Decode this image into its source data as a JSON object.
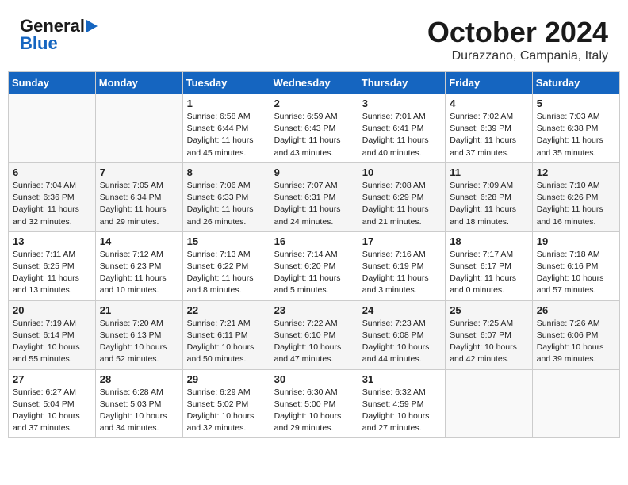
{
  "header": {
    "logo_general": "General",
    "logo_blue": "Blue",
    "month_title": "October 2024",
    "location": "Durazzano, Campania, Italy"
  },
  "columns": [
    "Sunday",
    "Monday",
    "Tuesday",
    "Wednesday",
    "Thursday",
    "Friday",
    "Saturday"
  ],
  "weeks": [
    {
      "days": [
        {
          "num": "",
          "detail": ""
        },
        {
          "num": "",
          "detail": ""
        },
        {
          "num": "1",
          "detail": "Sunrise: 6:58 AM\nSunset: 6:44 PM\nDaylight: 11 hours and 45 minutes."
        },
        {
          "num": "2",
          "detail": "Sunrise: 6:59 AM\nSunset: 6:43 PM\nDaylight: 11 hours and 43 minutes."
        },
        {
          "num": "3",
          "detail": "Sunrise: 7:01 AM\nSunset: 6:41 PM\nDaylight: 11 hours and 40 minutes."
        },
        {
          "num": "4",
          "detail": "Sunrise: 7:02 AM\nSunset: 6:39 PM\nDaylight: 11 hours and 37 minutes."
        },
        {
          "num": "5",
          "detail": "Sunrise: 7:03 AM\nSunset: 6:38 PM\nDaylight: 11 hours and 35 minutes."
        }
      ]
    },
    {
      "days": [
        {
          "num": "6",
          "detail": "Sunrise: 7:04 AM\nSunset: 6:36 PM\nDaylight: 11 hours and 32 minutes."
        },
        {
          "num": "7",
          "detail": "Sunrise: 7:05 AM\nSunset: 6:34 PM\nDaylight: 11 hours and 29 minutes."
        },
        {
          "num": "8",
          "detail": "Sunrise: 7:06 AM\nSunset: 6:33 PM\nDaylight: 11 hours and 26 minutes."
        },
        {
          "num": "9",
          "detail": "Sunrise: 7:07 AM\nSunset: 6:31 PM\nDaylight: 11 hours and 24 minutes."
        },
        {
          "num": "10",
          "detail": "Sunrise: 7:08 AM\nSunset: 6:29 PM\nDaylight: 11 hours and 21 minutes."
        },
        {
          "num": "11",
          "detail": "Sunrise: 7:09 AM\nSunset: 6:28 PM\nDaylight: 11 hours and 18 minutes."
        },
        {
          "num": "12",
          "detail": "Sunrise: 7:10 AM\nSunset: 6:26 PM\nDaylight: 11 hours and 16 minutes."
        }
      ]
    },
    {
      "days": [
        {
          "num": "13",
          "detail": "Sunrise: 7:11 AM\nSunset: 6:25 PM\nDaylight: 11 hours and 13 minutes."
        },
        {
          "num": "14",
          "detail": "Sunrise: 7:12 AM\nSunset: 6:23 PM\nDaylight: 11 hours and 10 minutes."
        },
        {
          "num": "15",
          "detail": "Sunrise: 7:13 AM\nSunset: 6:22 PM\nDaylight: 11 hours and 8 minutes."
        },
        {
          "num": "16",
          "detail": "Sunrise: 7:14 AM\nSunset: 6:20 PM\nDaylight: 11 hours and 5 minutes."
        },
        {
          "num": "17",
          "detail": "Sunrise: 7:16 AM\nSunset: 6:19 PM\nDaylight: 11 hours and 3 minutes."
        },
        {
          "num": "18",
          "detail": "Sunrise: 7:17 AM\nSunset: 6:17 PM\nDaylight: 11 hours and 0 minutes."
        },
        {
          "num": "19",
          "detail": "Sunrise: 7:18 AM\nSunset: 6:16 PM\nDaylight: 10 hours and 57 minutes."
        }
      ]
    },
    {
      "days": [
        {
          "num": "20",
          "detail": "Sunrise: 7:19 AM\nSunset: 6:14 PM\nDaylight: 10 hours and 55 minutes."
        },
        {
          "num": "21",
          "detail": "Sunrise: 7:20 AM\nSunset: 6:13 PM\nDaylight: 10 hours and 52 minutes."
        },
        {
          "num": "22",
          "detail": "Sunrise: 7:21 AM\nSunset: 6:11 PM\nDaylight: 10 hours and 50 minutes."
        },
        {
          "num": "23",
          "detail": "Sunrise: 7:22 AM\nSunset: 6:10 PM\nDaylight: 10 hours and 47 minutes."
        },
        {
          "num": "24",
          "detail": "Sunrise: 7:23 AM\nSunset: 6:08 PM\nDaylight: 10 hours and 44 minutes."
        },
        {
          "num": "25",
          "detail": "Sunrise: 7:25 AM\nSunset: 6:07 PM\nDaylight: 10 hours and 42 minutes."
        },
        {
          "num": "26",
          "detail": "Sunrise: 7:26 AM\nSunset: 6:06 PM\nDaylight: 10 hours and 39 minutes."
        }
      ]
    },
    {
      "days": [
        {
          "num": "27",
          "detail": "Sunrise: 6:27 AM\nSunset: 5:04 PM\nDaylight: 10 hours and 37 minutes."
        },
        {
          "num": "28",
          "detail": "Sunrise: 6:28 AM\nSunset: 5:03 PM\nDaylight: 10 hours and 34 minutes."
        },
        {
          "num": "29",
          "detail": "Sunrise: 6:29 AM\nSunset: 5:02 PM\nDaylight: 10 hours and 32 minutes."
        },
        {
          "num": "30",
          "detail": "Sunrise: 6:30 AM\nSunset: 5:00 PM\nDaylight: 10 hours and 29 minutes."
        },
        {
          "num": "31",
          "detail": "Sunrise: 6:32 AM\nSunset: 4:59 PM\nDaylight: 10 hours and 27 minutes."
        },
        {
          "num": "",
          "detail": ""
        },
        {
          "num": "",
          "detail": ""
        }
      ]
    }
  ]
}
